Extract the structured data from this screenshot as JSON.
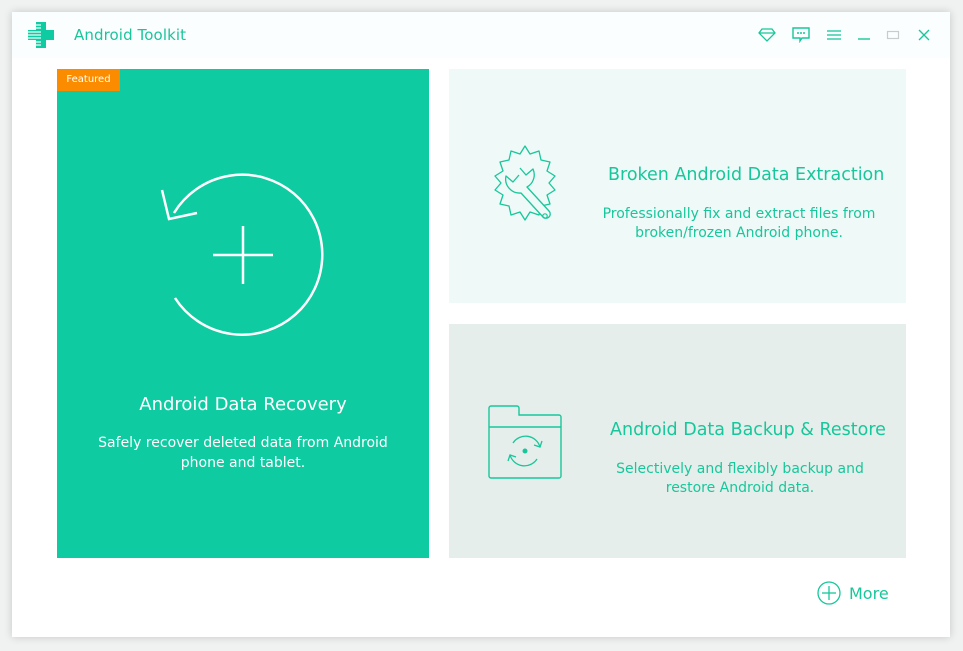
{
  "app": {
    "title": "Android Toolkit",
    "logo_icon": "medical-cross-logo-icon",
    "accent_color": "#0ecba2",
    "badge_color": "#fb8c00"
  },
  "window_controls": [
    {
      "name": "premium-icon",
      "label": "Register"
    },
    {
      "name": "feedback-icon",
      "label": "Feedback"
    },
    {
      "name": "menu-icon",
      "label": "Menu"
    },
    {
      "name": "minimize-icon",
      "label": "Minimize"
    },
    {
      "name": "maximize-icon",
      "label": "Maximize"
    },
    {
      "name": "close-icon",
      "label": "Close"
    }
  ],
  "cards": {
    "featured": {
      "badge": "Featured",
      "title": "Android Data Recovery",
      "description": "Safely recover deleted data from Android phone and tablet.",
      "icon": "recover-circle-plus-icon"
    },
    "broken": {
      "title": "Broken Android Data Extraction",
      "description_line1": "Professionally fix and extract files from",
      "description_line2": "broken/frozen Android phone.",
      "icon": "gear-wrench-icon"
    },
    "backup": {
      "title": "Android Data Backup & Restore",
      "description_line1": "Selectively and flexibly backup and",
      "description_line2": "restore Android data.",
      "icon": "folder-sync-icon"
    }
  },
  "more": {
    "label": "More",
    "icon": "plus-circle-icon"
  }
}
